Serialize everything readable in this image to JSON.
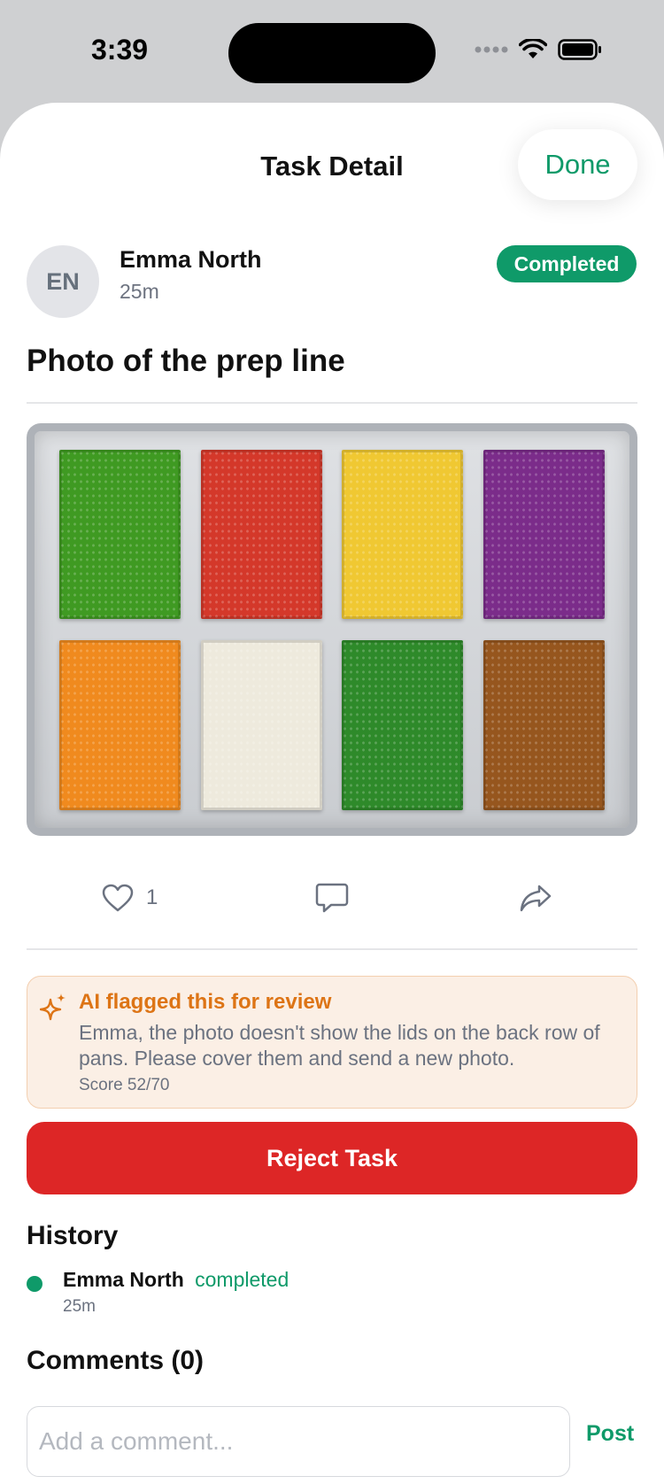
{
  "status_bar": {
    "time": "3:39"
  },
  "nav": {
    "title": "Task Detail",
    "done_label": "Done"
  },
  "user": {
    "initials": "EN",
    "name": "Emma North",
    "time_ago": "25m"
  },
  "status_badge": {
    "label": "Completed",
    "color": "#0f9a69"
  },
  "task": {
    "title": "Photo of the prep line"
  },
  "photo": {
    "pan_colors": [
      "#3f9a22",
      "#d4382a",
      "#f0c832",
      "#7b2c8a",
      "#f08a1e",
      "#eeeadd",
      "#2e8a2a",
      "#96561e"
    ]
  },
  "actions": {
    "like_count": "1"
  },
  "ai_flag": {
    "title": "AI flagged this for review",
    "message": "Emma, the photo doesn't show the lids on the back row of pans. Please cover them and send a new photo.",
    "score": "Score 52/70"
  },
  "reject_button": {
    "label": "Reject Task"
  },
  "history": {
    "title": "History",
    "entries": [
      {
        "name": "Emma North",
        "action": "completed",
        "time": "25m"
      }
    ]
  },
  "comments": {
    "title": "Comments (0)",
    "input_placeholder": "Add a comment...",
    "post_label": "Post"
  },
  "colors": {
    "accent": "#0f9a69",
    "danger": "#dd2626",
    "warning": "#dd7415"
  }
}
